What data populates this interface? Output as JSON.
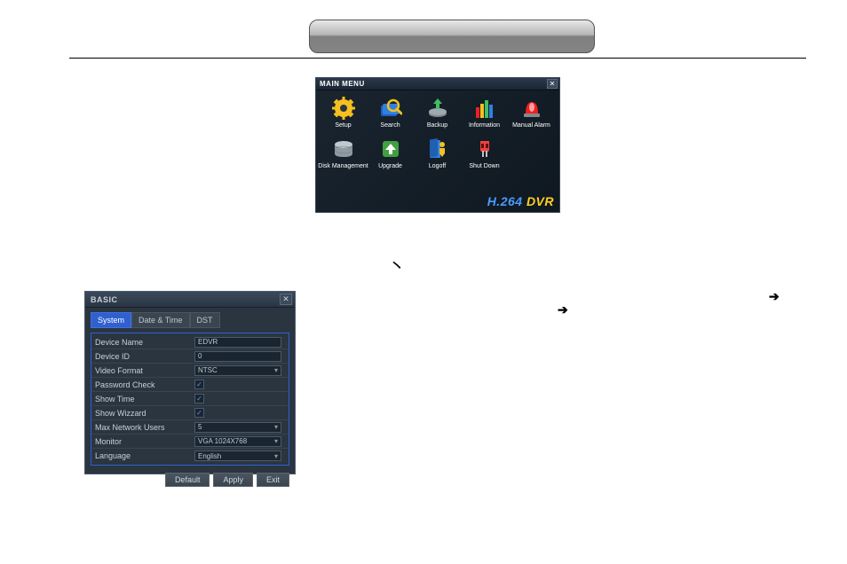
{
  "main_menu": {
    "title": "MAIN MENU",
    "close": "✕",
    "items": [
      {
        "label": "Setup",
        "icon": "gear"
      },
      {
        "label": "Search",
        "icon": "search"
      },
      {
        "label": "Backup",
        "icon": "backup"
      },
      {
        "label": "Information",
        "icon": "info"
      },
      {
        "label": "Manual Alarm",
        "icon": "alarm"
      },
      {
        "label": "Disk Management",
        "icon": "disk"
      },
      {
        "label": "Upgrade",
        "icon": "upgrade"
      },
      {
        "label": "Logoff",
        "icon": "logoff"
      },
      {
        "label": "Shut Down",
        "icon": "shutdown"
      }
    ],
    "brand_prefix": "H.264 ",
    "brand_suffix": "DVR"
  },
  "basic": {
    "title": "BASIC",
    "close": "✕",
    "tabs": [
      {
        "label": "System",
        "active": true
      },
      {
        "label": "Date & Time",
        "active": false
      },
      {
        "label": "DST",
        "active": false
      }
    ],
    "rows": {
      "device_name": {
        "label": "Device Name",
        "value": "EDVR"
      },
      "device_id": {
        "label": "Device ID",
        "value": "0"
      },
      "video_format": {
        "label": "Video Format",
        "value": "NTSC"
      },
      "password_check": {
        "label": "Password Check",
        "checked": true
      },
      "show_time": {
        "label": "Show Time",
        "checked": true
      },
      "show_wizard": {
        "label": "Show Wizzard",
        "checked": true
      },
      "max_users": {
        "label": "Max Network Users",
        "value": "5"
      },
      "monitor": {
        "label": "Monitor",
        "value": "VGA 1024X768"
      },
      "language": {
        "label": "Language",
        "value": "English"
      }
    },
    "buttons": {
      "default": "Default",
      "apply": "Apply",
      "exit": "Exit"
    }
  },
  "symbols": {
    "accent": "丶",
    "arrow": "➔"
  }
}
